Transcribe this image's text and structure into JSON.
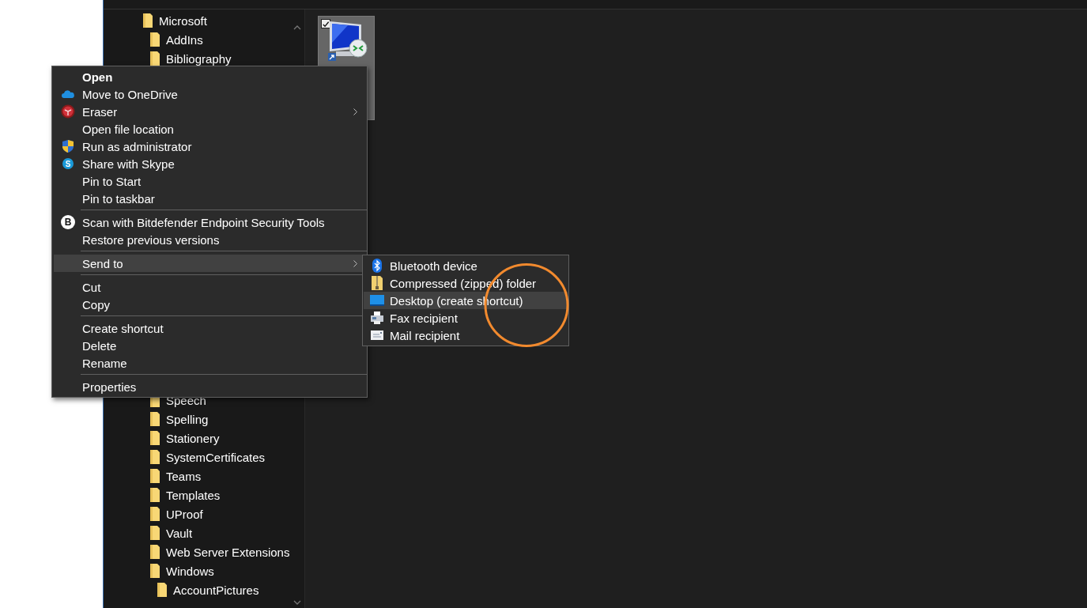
{
  "tree": {
    "items": [
      {
        "label": "Microsoft",
        "children": [
          {
            "label": "AddIns"
          },
          {
            "label": "Bibliography"
          },
          {
            "label": "Speech"
          },
          {
            "label": "Spelling"
          },
          {
            "label": "Stationery"
          },
          {
            "label": "SystemCertificates"
          },
          {
            "label": "Teams"
          },
          {
            "label": "Templates"
          },
          {
            "label": "UProof"
          },
          {
            "label": "Vault"
          },
          {
            "label": "Web Server Extensions"
          },
          {
            "label": "Windows",
            "children": [
              {
                "label": "AccountPictures"
              }
            ]
          }
        ]
      }
    ]
  },
  "file": {
    "selected": true,
    "checked": true
  },
  "context_menu": {
    "items": [
      {
        "kind": "item",
        "label": "Open",
        "bold": true,
        "submenu": false,
        "selected": false
      },
      {
        "kind": "icon_item",
        "label": "Move to OneDrive",
        "bold": false,
        "submenu": false,
        "selected": false
      },
      {
        "kind": "icon_item",
        "label": "Eraser",
        "bold": false,
        "submenu": true,
        "selected": false
      },
      {
        "kind": "item",
        "label": "Open file location",
        "bold": false,
        "submenu": false,
        "selected": false
      },
      {
        "kind": "icon_item",
        "label": "Run as administrator",
        "bold": false,
        "submenu": false,
        "selected": false
      },
      {
        "kind": "icon_item",
        "label": "Share with Skype",
        "icon_text": "S",
        "bold": false,
        "submenu": false,
        "selected": false
      },
      {
        "kind": "item",
        "label": "Pin to Start",
        "bold": false,
        "submenu": false,
        "selected": false
      },
      {
        "kind": "item",
        "label": "Pin to taskbar",
        "bold": false,
        "submenu": false,
        "selected": false
      },
      {
        "kind": "separator"
      },
      {
        "kind": "icon_item",
        "label": "Scan with Bitdefender Endpoint Security Tools",
        "icon_text": "B",
        "bold": false,
        "submenu": false,
        "selected": false
      },
      {
        "kind": "item",
        "label": "Restore previous versions",
        "bold": false,
        "submenu": false,
        "selected": false
      },
      {
        "kind": "separator"
      },
      {
        "kind": "item",
        "label": "Send to",
        "bold": false,
        "submenu": true,
        "selected": true
      },
      {
        "kind": "separator"
      },
      {
        "kind": "item",
        "label": "Cut",
        "bold": false,
        "submenu": false,
        "selected": false
      },
      {
        "kind": "item",
        "label": "Copy",
        "bold": false,
        "submenu": false,
        "selected": false
      },
      {
        "kind": "separator"
      },
      {
        "kind": "item",
        "label": "Create shortcut",
        "bold": false,
        "submenu": false,
        "selected": false
      },
      {
        "kind": "item",
        "label": "Delete",
        "bold": false,
        "submenu": false,
        "selected": false
      },
      {
        "kind": "item",
        "label": "Rename",
        "bold": false,
        "submenu": false,
        "selected": false
      },
      {
        "kind": "separator"
      },
      {
        "kind": "item",
        "label": "Properties",
        "bold": false,
        "submenu": false,
        "selected": false
      }
    ]
  },
  "send_to_menu": {
    "items": [
      {
        "label": "Bluetooth device",
        "selected": false
      },
      {
        "label": "Compressed (zipped) folder",
        "selected": false
      },
      {
        "label": "Desktop (create shortcut)",
        "selected": true
      },
      {
        "label": "Fax recipient",
        "selected": false
      },
      {
        "label": "Mail recipient",
        "selected": false
      }
    ]
  }
}
